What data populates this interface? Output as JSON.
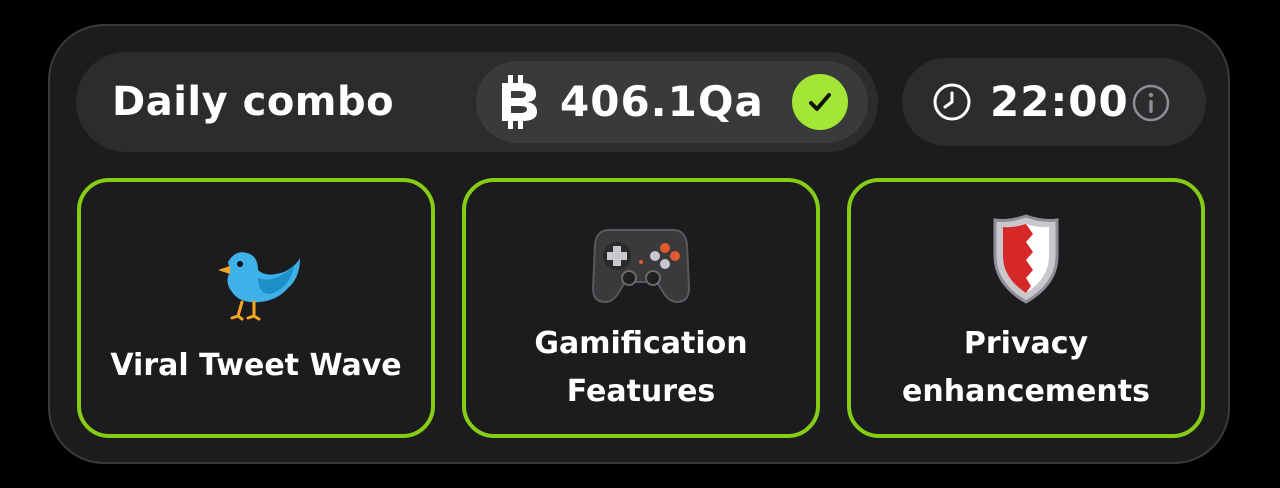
{
  "header": {
    "title": "Daily combo",
    "balance": "406.1Qa",
    "balance_icon": "coin-icon",
    "status_icon": "check-icon",
    "timer": "22:00",
    "timer_icon": "clock-icon",
    "info_icon": "info-icon"
  },
  "cards": [
    {
      "label": "Viral Tweet Wave",
      "icon": "bird-icon"
    },
    {
      "label": "Gamification\nFeatures",
      "icon": "gamepad-icon"
    },
    {
      "label": "Privacy\nenhancements",
      "icon": "shield-icon"
    }
  ],
  "colors": {
    "accent": "#84cc16",
    "check_bg": "#a3e635",
    "panel_bg": "#1c1c1e",
    "pill_bg": "#2c2c2e",
    "text": "#ffffff"
  }
}
